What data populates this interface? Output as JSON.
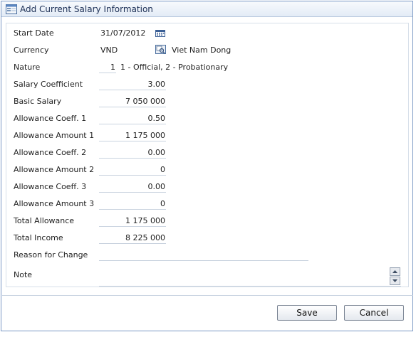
{
  "dialog": {
    "title": "Add Current Salary Information"
  },
  "form": {
    "start_date": {
      "label": "Start Date",
      "value": "31/07/2012"
    },
    "currency": {
      "label": "Currency",
      "value": "VND",
      "description": "Viet Nam Dong"
    },
    "nature": {
      "label": "Nature",
      "value": "1",
      "hint": "1 - Official, 2 - Probationary"
    },
    "salary_coefficient": {
      "label": "Salary Coefficient",
      "value": "3.00"
    },
    "basic_salary": {
      "label": "Basic Salary",
      "value": "7 050 000"
    },
    "allowance_coeff_1": {
      "label": "Allowance Coeff. 1",
      "value": "0.50"
    },
    "allowance_amount_1": {
      "label": "Allowance Amount 1",
      "value": "1 175 000"
    },
    "allowance_coeff_2": {
      "label": "Allowance Coeff. 2",
      "value": "0.00"
    },
    "allowance_amount_2": {
      "label": "Allowance Amount 2",
      "value": "0"
    },
    "allowance_coeff_3": {
      "label": "Allowance Coeff. 3",
      "value": "0.00"
    },
    "allowance_amount_3": {
      "label": "Allowance Amount 3",
      "value": "0"
    },
    "total_allowance": {
      "label": "Total Allowance",
      "value": "1 175 000"
    },
    "total_income": {
      "label": "Total Income",
      "value": "8 225 000"
    },
    "reason_for_change": {
      "label": "Reason for Change",
      "value": ""
    },
    "note": {
      "label": "Note",
      "value": ""
    }
  },
  "buttons": {
    "save": "Save",
    "cancel": "Cancel"
  },
  "icons": {
    "title": "window-form-icon",
    "calendar": "calendar-icon",
    "lookup": "lookup-icon",
    "spin_up": "spin-up-icon",
    "spin_down": "spin-down-icon"
  }
}
